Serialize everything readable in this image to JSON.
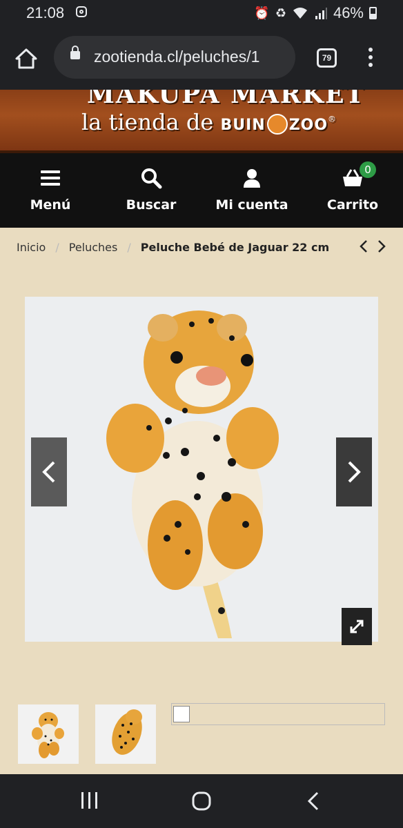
{
  "status_bar": {
    "time": "21:08",
    "battery": "46%",
    "icons": [
      "instagram-icon",
      "alarm-icon",
      "data-saver-icon",
      "wifi-icon",
      "signal-icon",
      "battery-icon"
    ]
  },
  "browser": {
    "url": "zootienda.cl/peluches/1",
    "tab_count": "79"
  },
  "banner": {
    "line1": "MAKUPA MARKET",
    "line2_prefix": "la tienda de",
    "brand_left": "BUIN",
    "brand_right": "ZOO",
    "reg": "®"
  },
  "nav": {
    "menu": "Menú",
    "search": "Buscar",
    "account": "Mi cuenta",
    "cart": "Carrito",
    "cart_count": "0"
  },
  "breadcrumb": {
    "items": [
      "Inicio",
      "Peluches"
    ],
    "current": "Peluche Bebé de Jaguar 22 cm"
  },
  "colors": {
    "page_bg": "#e9dcc0",
    "nav_bg": "#111111",
    "badge_green": "#2e9c46",
    "banner_brown": "#8a3f17"
  }
}
